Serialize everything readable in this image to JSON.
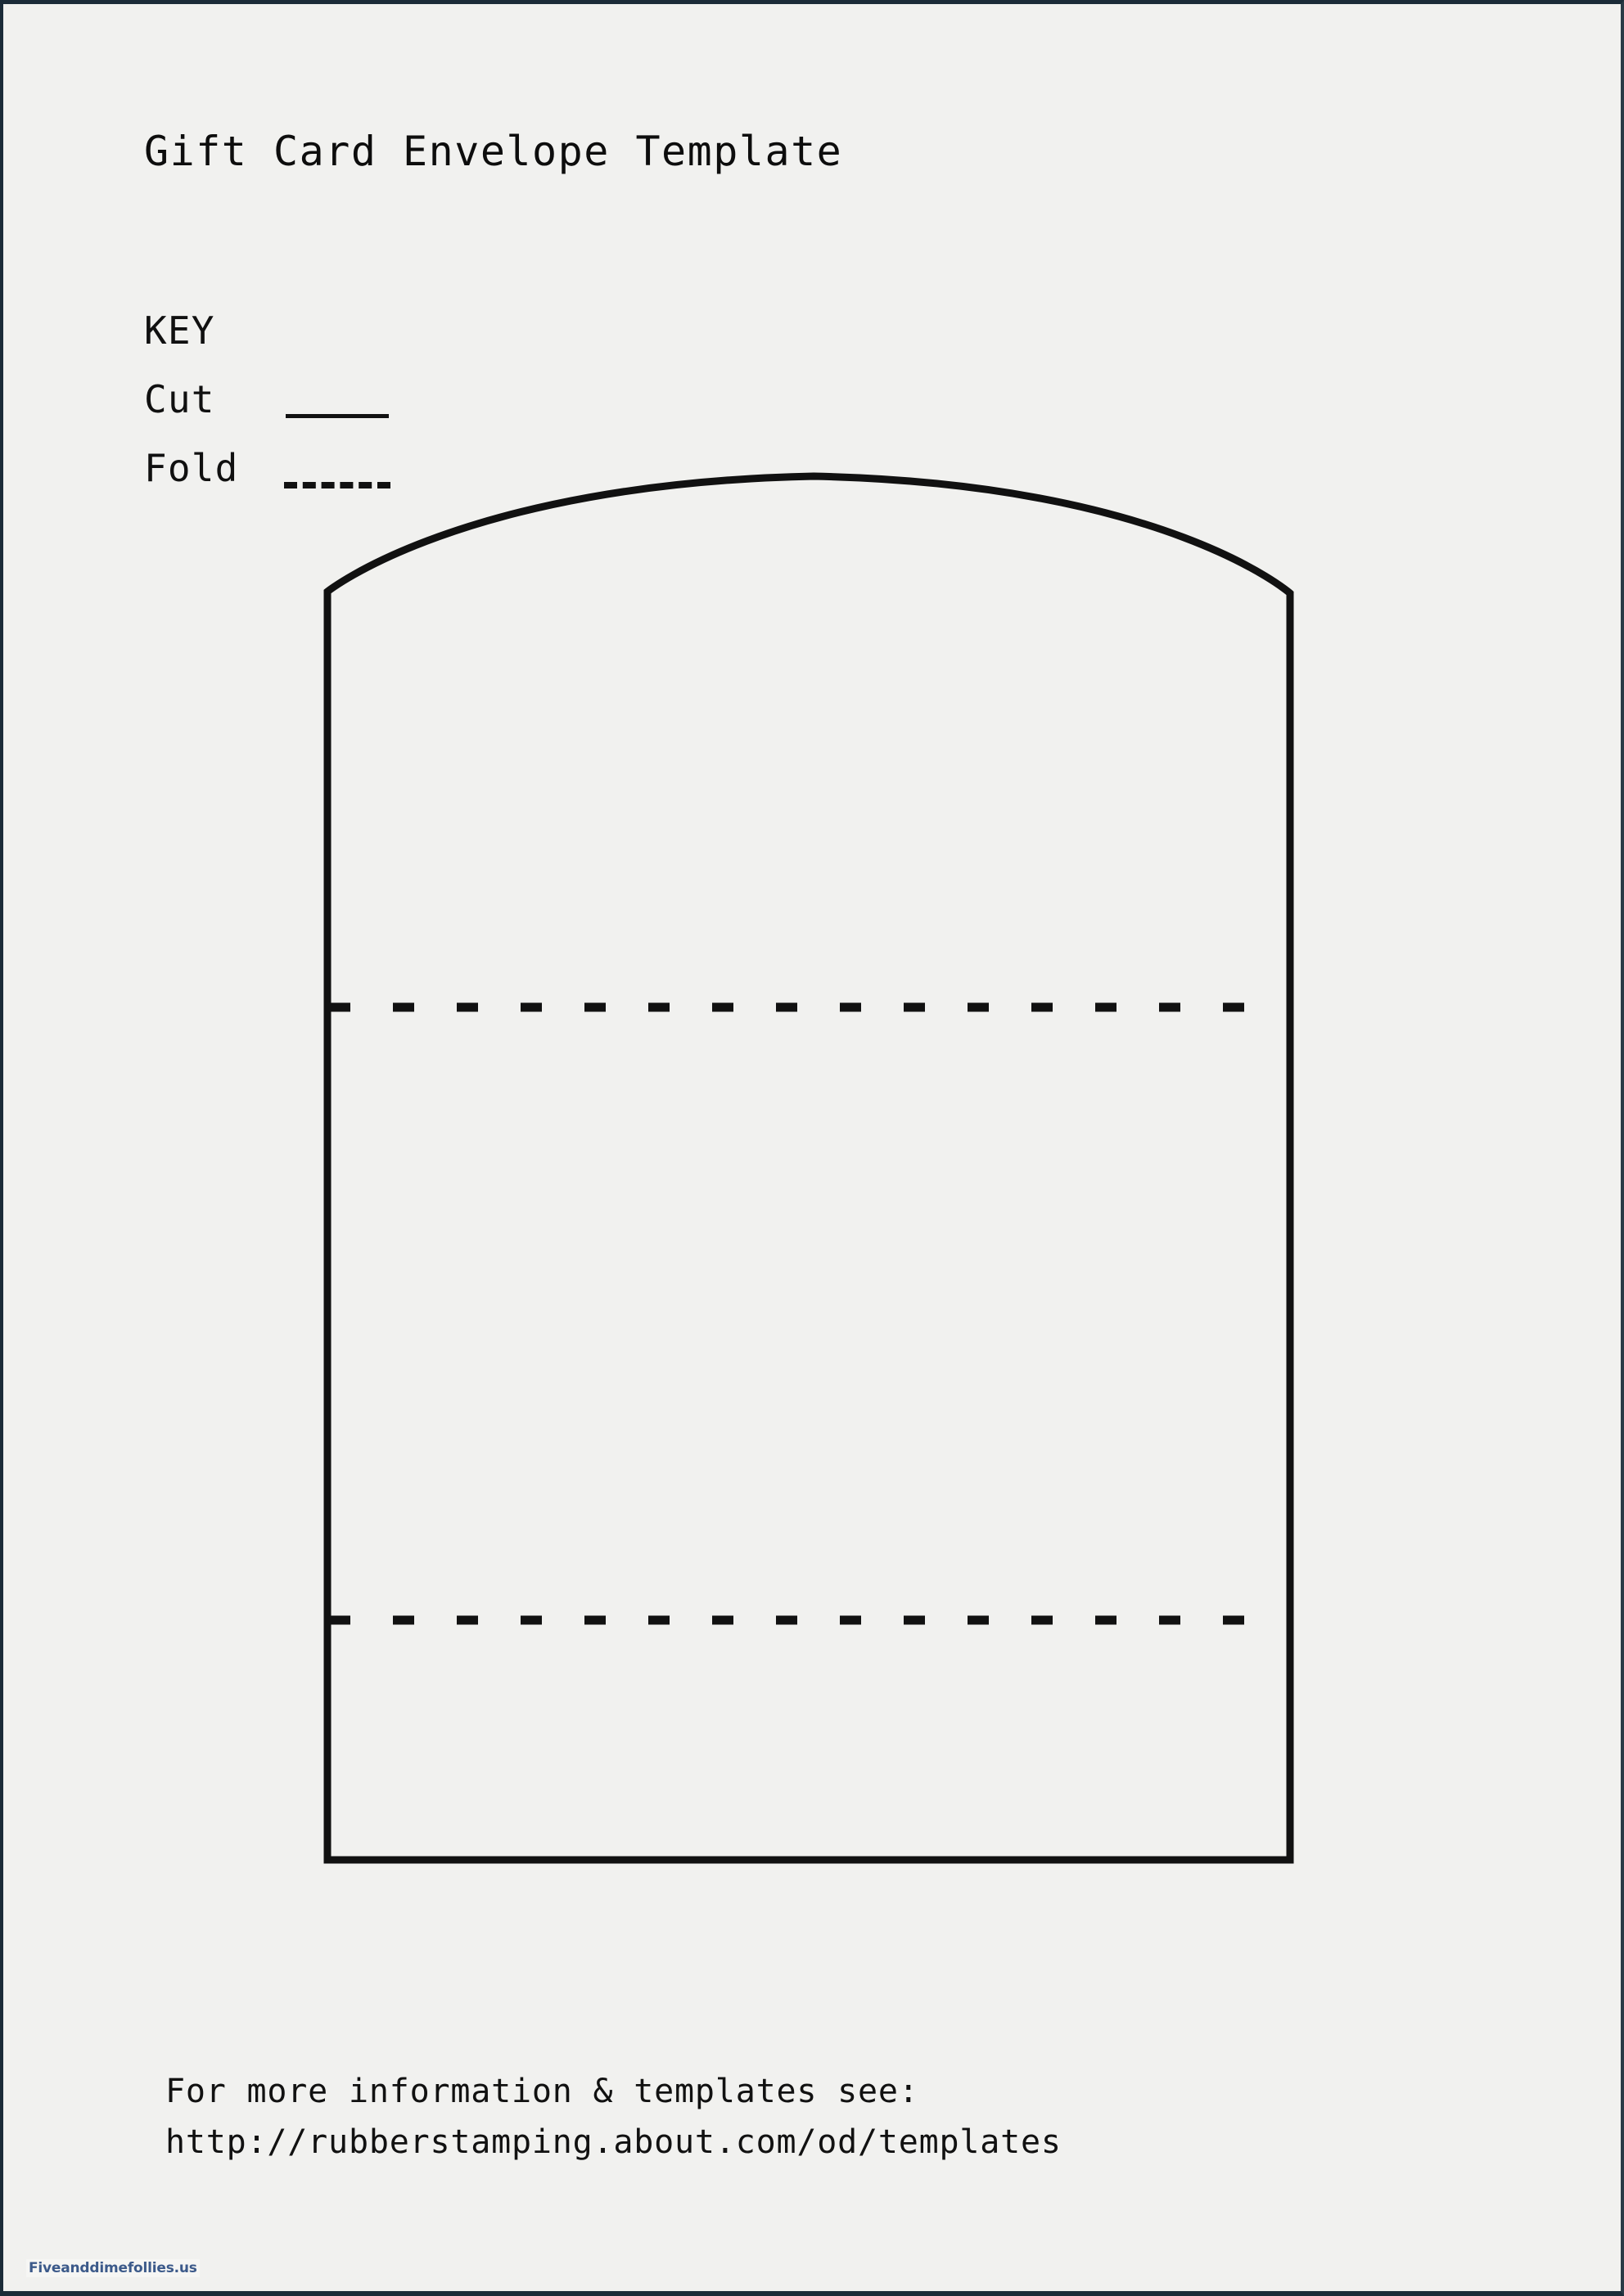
{
  "page": {
    "title": "Gift Card Envelope Template",
    "background_color": "#f1f1ef",
    "border_color": "#1b2b38",
    "ink_color": "#111111"
  },
  "key": {
    "heading": "KEY",
    "items": [
      {
        "label": "Cut",
        "line_style": "solid"
      },
      {
        "label": "Fold",
        "line_style": "dashed"
      }
    ]
  },
  "template": {
    "shape_name": "envelope-outline",
    "outline_style": "solid",
    "fold_lines": [
      {
        "name": "upper-fold-line",
        "style": "dashed"
      },
      {
        "name": "lower-fold-line",
        "style": "dashed"
      }
    ]
  },
  "footer": {
    "line1": "For more information & templates see:",
    "line2": "http://rubberstamping.about.com/od/templates"
  },
  "watermark": {
    "text": "Fiveanddimefollies.us",
    "color": "#3c5a8a"
  }
}
